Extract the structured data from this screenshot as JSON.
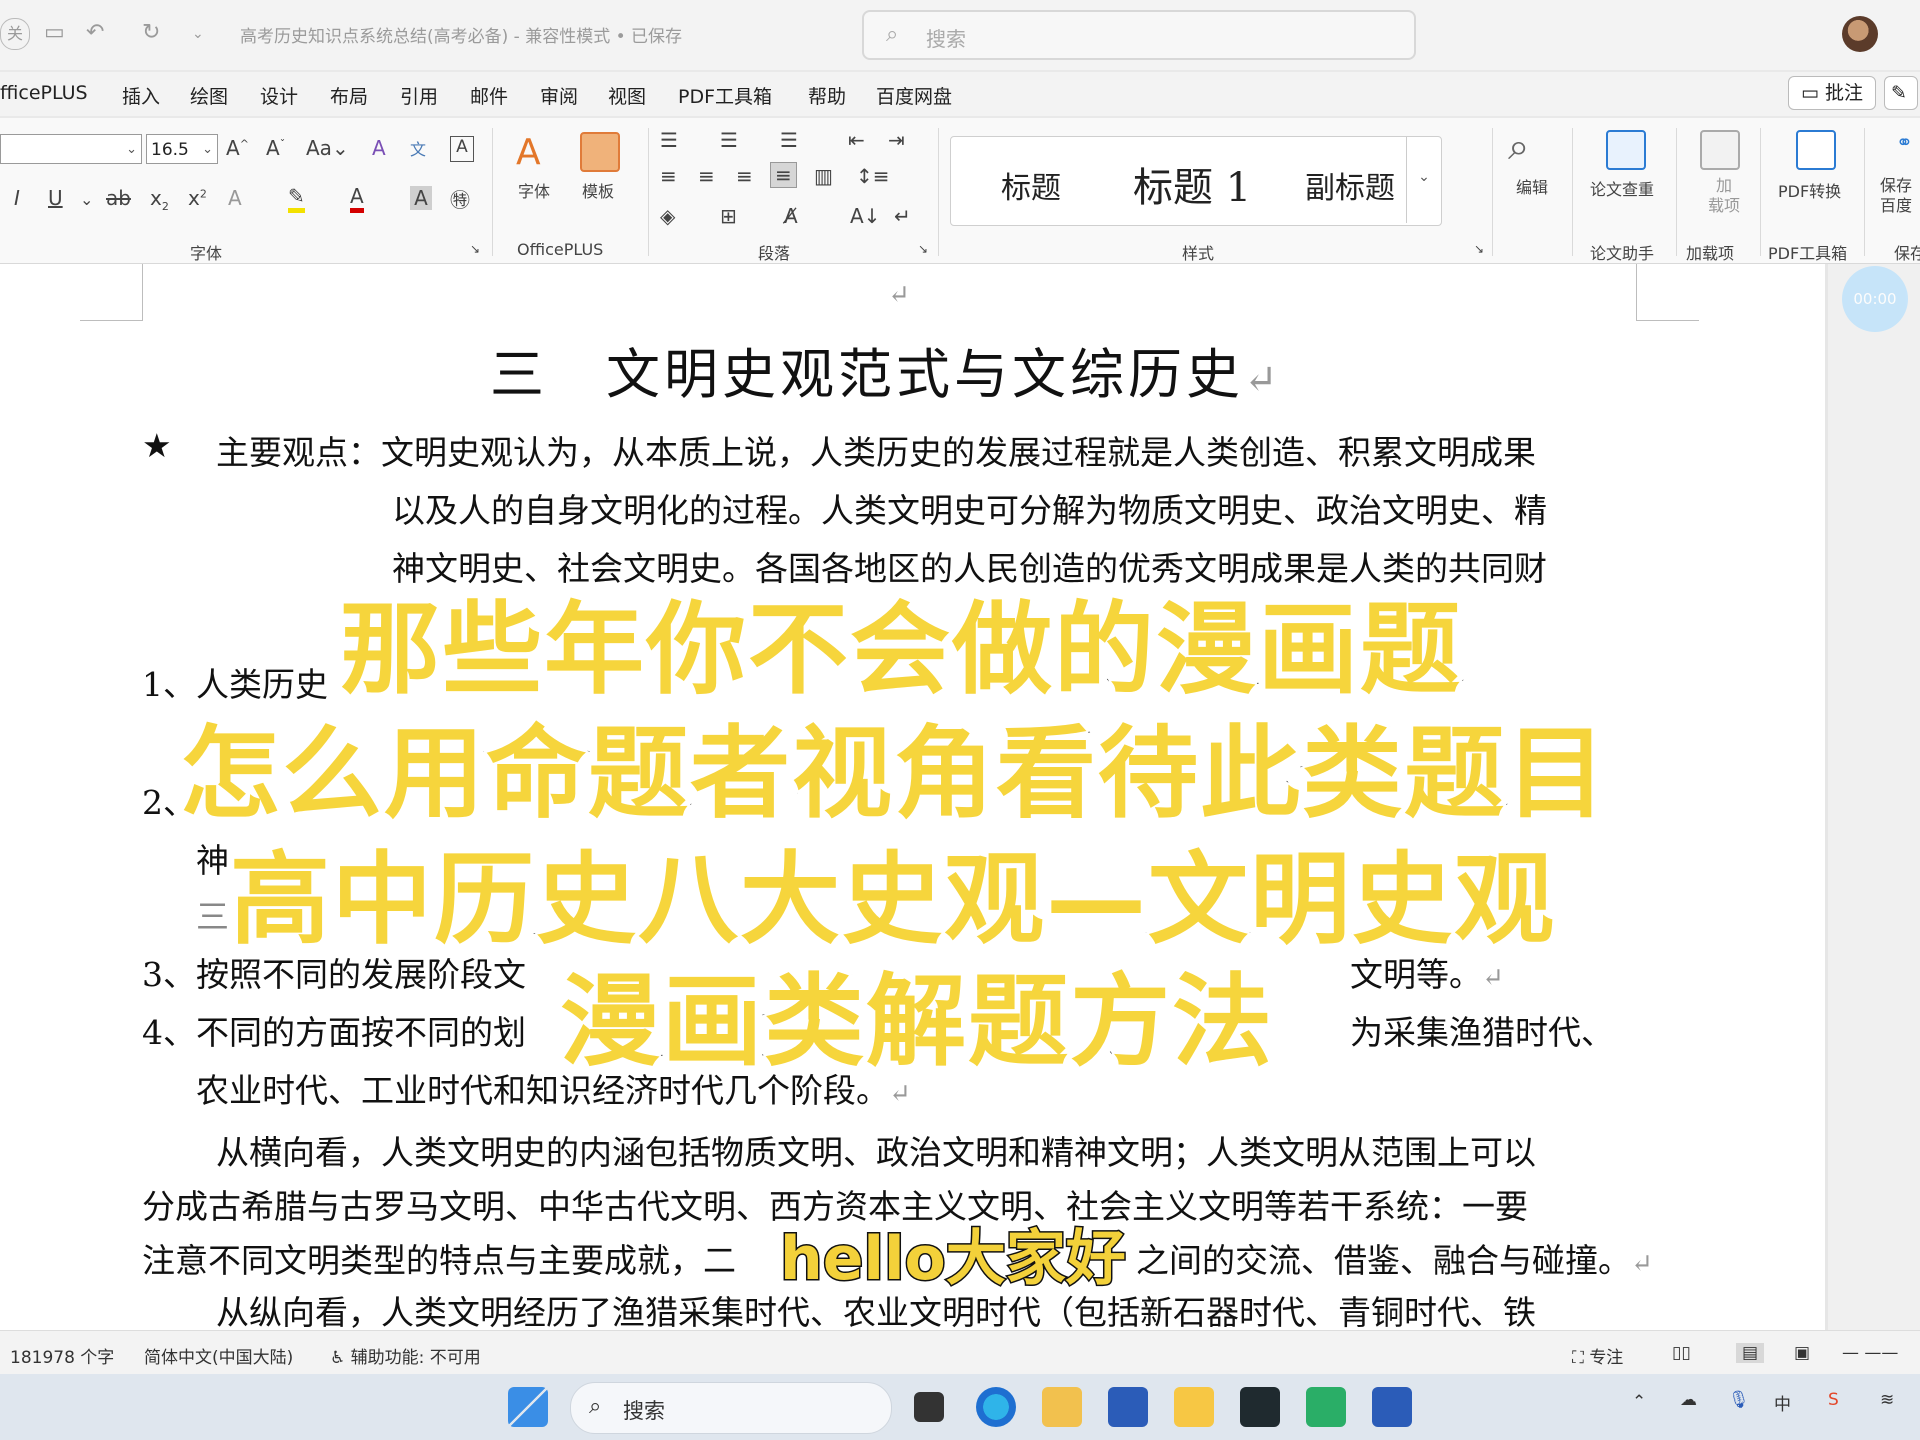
{
  "titlebar": {
    "close_label": "关",
    "document_title": "高考历史知识点系统总结(高考必备)  -  兼容性模式  •  已保存",
    "search_placeholder": "搜索"
  },
  "tabs": [
    "fficePLUS",
    "插入",
    "绘图",
    "设计",
    "布局",
    "引用",
    "邮件",
    "审阅",
    "视图",
    "PDF工具箱",
    "帮助",
    "百度网盘"
  ],
  "comment_label": "批注",
  "ribbon": {
    "font_size": "16.5",
    "group_font": "字体",
    "group_officeplus": "OfficePLUS",
    "group_paragraph": "段落",
    "group_styles": "样式",
    "group_paper": "论文助手",
    "group_addins": "加载项",
    "group_pdf": "PDF工具箱",
    "group_save": "保存",
    "btn_font": "字体",
    "btn_template": "模板",
    "btn_edit": "编辑",
    "btn_paper": "论文查重",
    "btn_addin": "加\n载项",
    "btn_pdf": "PDF转换",
    "btn_save": "保存\n百度",
    "styles": [
      "标题",
      "标题 1",
      "副标题"
    ]
  },
  "timer": "00:00",
  "document": {
    "heading": "三　文明史观范式与文综历史",
    "star_line1": "主要观点：文明史观认为，从本质上说，人类历史的发展过程就是人类创造、积累文明成果",
    "star_line2": "以及人的自身文明化的过程。人类文明史可分解为物质文明史、政治文明史、精",
    "star_line3": "神文明史、社会文明史。各国各地区的人民创造的优秀文明成果是人类的共同财",
    "item1": "1、人类历史",
    "item2a": "2、",
    "item2b": "神",
    "item2c": "三",
    "item3a": "3、按照不同的发展阶段文",
    "item3b": "文明等。",
    "item4a": "4、不同的方面按不同的划",
    "item4b": "为采集渔猎时代、",
    "item4c": "农业时代、工业时代和知识经济时代几个阶段。",
    "para1_line1": "从横向看，人类文明史的内涵包括物质文明、政治文明和精神文明；人类文明从范围上可以",
    "para1_line2": "分成古希腊与古罗马文明、中华古代文明、西方资本主义文明、社会主义文明等若干系统：一要",
    "para1_line3a": "注意不同文明类型的特点与主要成就，二",
    "para1_line3b": "之间的交流、借鉴、融合与碰撞。",
    "para2_line1": "从纵向看，人类文明经历了渔猎采集时代、农业文明时代（包括新石器时代、青铜时代、铁"
  },
  "overlay": {
    "line1": "那些年你不会做的漫画题",
    "line2": "怎么用命题者视角看待此类题目",
    "line3": "高中历史八大史观—文明史观",
    "line4": "漫画类解题方法",
    "subtitle": "hello大家好"
  },
  "statusbar": {
    "word_count": "181978 个字",
    "language": "简体中文(中国大陆)",
    "accessibility": "辅助功能: 不可用",
    "focus": "专注"
  },
  "taskbar": {
    "search_placeholder": "搜索"
  }
}
